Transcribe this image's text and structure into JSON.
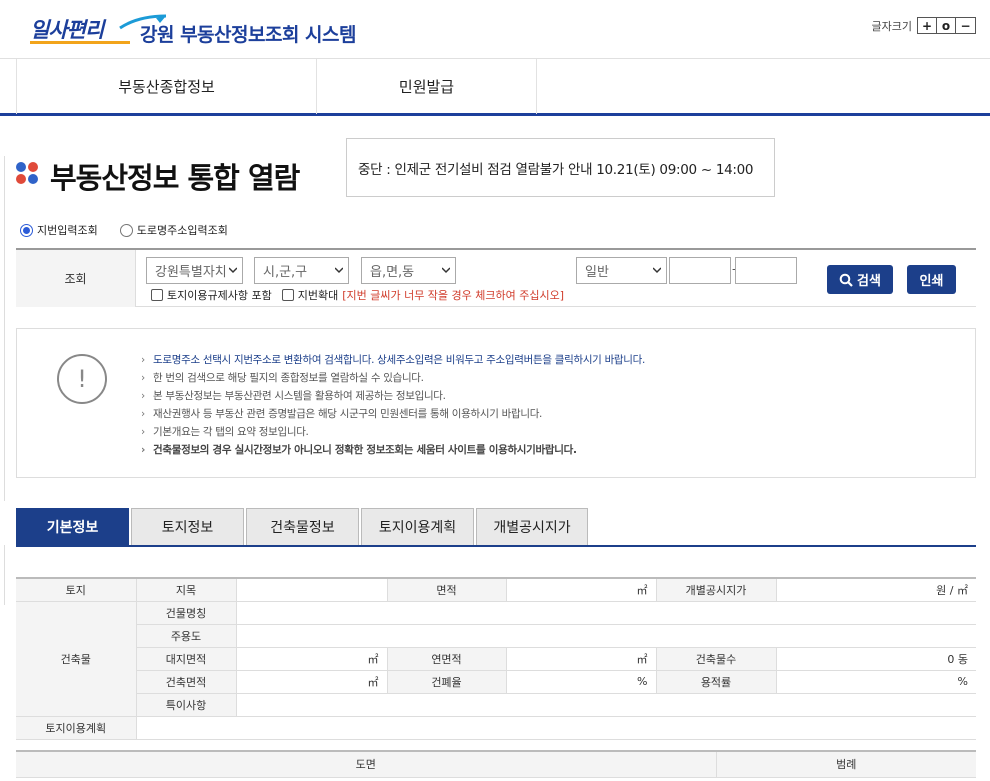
{
  "header": {
    "logo_text": "일사편리",
    "system_title": "강원  부동산정보조회 시스템",
    "font_size_label": "글자크기",
    "font_buttons": [
      "+",
      "o",
      "−"
    ]
  },
  "nav": {
    "items": [
      {
        "label": "부동산종합정보"
      },
      {
        "label": "민원발급"
      }
    ]
  },
  "page": {
    "title": "부동산정보 통합 열람",
    "notice": "중단 : 인제군 전기설비 점검 열람불가 안내 10.21(토) 09:00 ~ 14:00"
  },
  "search_mode": {
    "options": [
      {
        "label": "지번입력조회",
        "selected": true
      },
      {
        "label": "도로명주소입력조회",
        "selected": false
      }
    ]
  },
  "search": {
    "label": "조회",
    "province": "강원특별자치",
    "city": "시,군,구",
    "town": "읍,면,동",
    "land_type": "일반",
    "main_number": "",
    "sub_number": "",
    "dash": "-",
    "check_regulation": "토지이용규제사항 포함",
    "check_enlarge": "지번확대",
    "enlarge_note": "[지번 글씨가 너무 작을 경우 체크하여 주십시오]",
    "search_button": "검색",
    "print_button": "인쇄"
  },
  "info": {
    "icon": "exclamation-icon",
    "lines": [
      "도로명주소 선택시 지번주소로 변환하여 검색합니다. 상세주소입력은 비워두고 주소입력버튼을 클릭하시기 바랍니다.",
      "한 번의 검색으로 해당 필지의 종합정보를 열람하실 수 있습니다.",
      "본 부동산정보는 부동산관련 시스템을 활용하여 제공하는 정보입니다.",
      "재산권행사 등 부동산 관련 증명발급은 해당 시군구의 민원센터를 통해 이용하시기 바랍니다.",
      "기본개요는 각 탭의 요약 정보입니다.",
      "건축물정보의 경우 실시간정보가 아니오니 정확한 정보조회는 세움터 사이트를 이용하시기바랍니다."
    ]
  },
  "tabs": [
    {
      "label": "기본정보",
      "active": true
    },
    {
      "label": "토지정보",
      "active": false
    },
    {
      "label": "건축물정보",
      "active": false
    },
    {
      "label": "토지이용계획",
      "active": false
    },
    {
      "label": "개별공시지가",
      "active": false
    }
  ],
  "basic": {
    "land": "토지",
    "jimok": "지목",
    "area": "면적",
    "area_unit": "㎡",
    "price": "개별공시지가",
    "price_unit": "원 / ㎡",
    "building": "건축물",
    "building_name": "건물명칭",
    "main_use": "주용도",
    "site_area": "대지면적",
    "site_area_unit": "㎡",
    "total_area": "연면적",
    "total_area_unit": "㎡",
    "building_count": "건축물수",
    "building_count_value": "0 동",
    "building_area": "건축면적",
    "building_area_unit": "㎡",
    "coverage": "건폐율",
    "coverage_unit": "%",
    "far": "용적률",
    "far_unit": "%",
    "special": "특이사항",
    "land_plan": "토지이용계획"
  },
  "map_table": {
    "drawing": "도면",
    "legend": "범례"
  },
  "colors": {
    "brand": "#1c3f8a",
    "logo_accent": "#f2a41b",
    "warn": "#d03b2a",
    "dot_blue": "#2f63c9",
    "dot_red": "#e04a3a"
  }
}
